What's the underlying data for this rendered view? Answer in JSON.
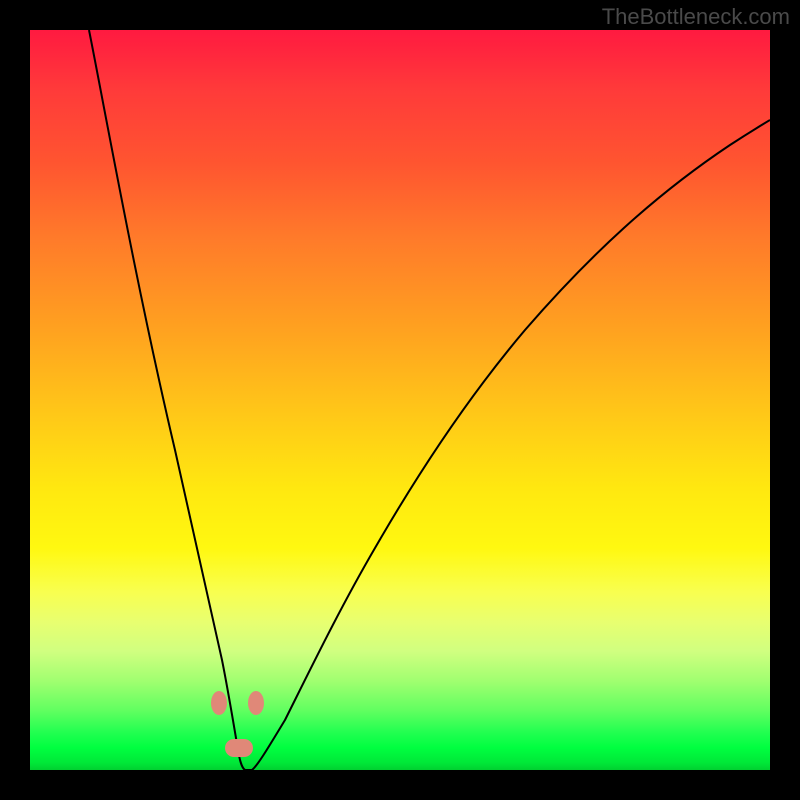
{
  "watermark": "TheBottleneck.com",
  "chart_data": {
    "type": "line",
    "title": "",
    "xlabel": "",
    "ylabel": "",
    "xlim": [
      0,
      100
    ],
    "ylim": [
      0,
      100
    ],
    "series": [
      {
        "name": "curve",
        "x": [
          8,
          12,
          16,
          20,
          22,
          24,
          25,
          26,
          27,
          28,
          29,
          30,
          32,
          35,
          40,
          45,
          50,
          55,
          60,
          65,
          70,
          75,
          80,
          85,
          90,
          95,
          100
        ],
        "values": [
          100,
          85,
          68,
          48,
          38,
          28,
          20,
          14,
          8,
          4,
          2,
          0,
          4,
          10,
          22,
          33,
          42,
          50,
          57,
          63,
          68,
          72,
          76,
          79,
          82,
          84,
          86
        ]
      }
    ],
    "markers": [
      {
        "x": 25.5,
        "y": 9
      },
      {
        "x": 30.5,
        "y": 9
      },
      {
        "x": 28,
        "y": 3
      }
    ],
    "annotations": []
  }
}
